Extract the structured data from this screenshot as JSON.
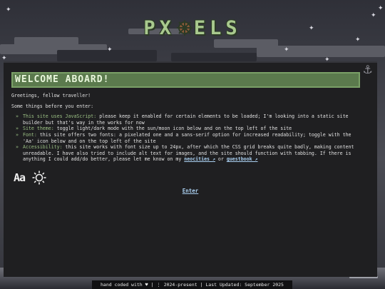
{
  "logo": {
    "text_left": "PX",
    "text_right": "ELS",
    "emblem": "ship-wheel-icon"
  },
  "header": {
    "title": "WELCOME ABOARD!",
    "corner_icon": "anchor-icon"
  },
  "intro": {
    "greeting": "Greetings, fellow traveller!",
    "lead": "Some things before you enter:"
  },
  "notes": [
    {
      "head": "This site uses JavaScript:",
      "text": " please keep it enabled for certain elements to be loaded; I'm looking into a static site builder but that's way in the works for now"
    },
    {
      "head": "Site theme:",
      "text": " toggle light/dark mode with the sun/moon icon below and on the top left of the site"
    },
    {
      "head": "Font:",
      "text": " this site offers two fonts: a pixelated one and a sans-serif option for increased readability; toggle with the 'Aa' icon below and on the top left of the site"
    },
    {
      "head": "Accessibility:",
      "text": " this site works with font size up to 24px, after which the CSS grid breaks quite badly, making content unreadable. I have also tried to include alt text for images, and the site should function with tabbing. If there is anything I could add/do better, please let me know on my ",
      "link1": "neocities ↗",
      "mid": " or ",
      "link2": "guestbook ↗"
    }
  ],
  "toggles": {
    "font_label": "Aa",
    "theme_icon": "sun-icon"
  },
  "enter_label": "Enter",
  "footer": "hand coded with ♥ | ⋮ 2024-present | Last Updated: September 2025",
  "colors": {
    "panel": "#1f1f21",
    "accent": "#5b7a4d",
    "highlight": "#9bc084",
    "link": "#a9cff0"
  }
}
